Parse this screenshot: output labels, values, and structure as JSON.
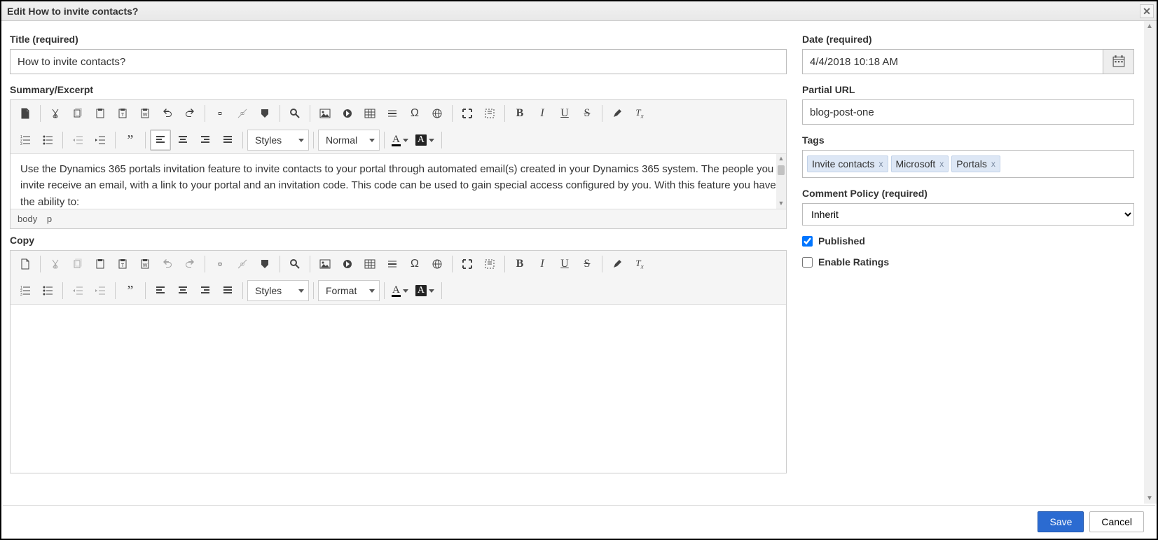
{
  "window": {
    "title": "Edit How to invite contacts?"
  },
  "main": {
    "title_label": "Title (required)",
    "title_value": "How to invite contacts?",
    "summary_label": "Summary/Excerpt",
    "summary_body": "Use the Dynamics 365 portals invitation feature to invite contacts to your portal through automated email(s) created in your Dynamics 365 system. The people you invite receive an email, with a link to your portal and an invitation code. This code can be used to gain special access configured by you. With this feature you have the ability to:",
    "summary_path1": "body",
    "summary_path2": "p",
    "copy_label": "Copy",
    "toolbar": {
      "styles": "Styles",
      "normal": "Normal",
      "format": "Format"
    }
  },
  "side": {
    "date_label": "Date (required)",
    "date_value": "4/4/2018 10:18 AM",
    "partial_url_label": "Partial URL",
    "partial_url_value": "blog-post-one",
    "tags_label": "Tags",
    "tags": [
      "Invite contacts",
      "Microsoft",
      "Portals"
    ],
    "comment_policy_label": "Comment Policy (required)",
    "comment_policy_value": "Inherit",
    "published_label": "Published",
    "published_checked": true,
    "ratings_label": "Enable Ratings",
    "ratings_checked": false
  },
  "footer": {
    "save": "Save",
    "cancel": "Cancel"
  }
}
